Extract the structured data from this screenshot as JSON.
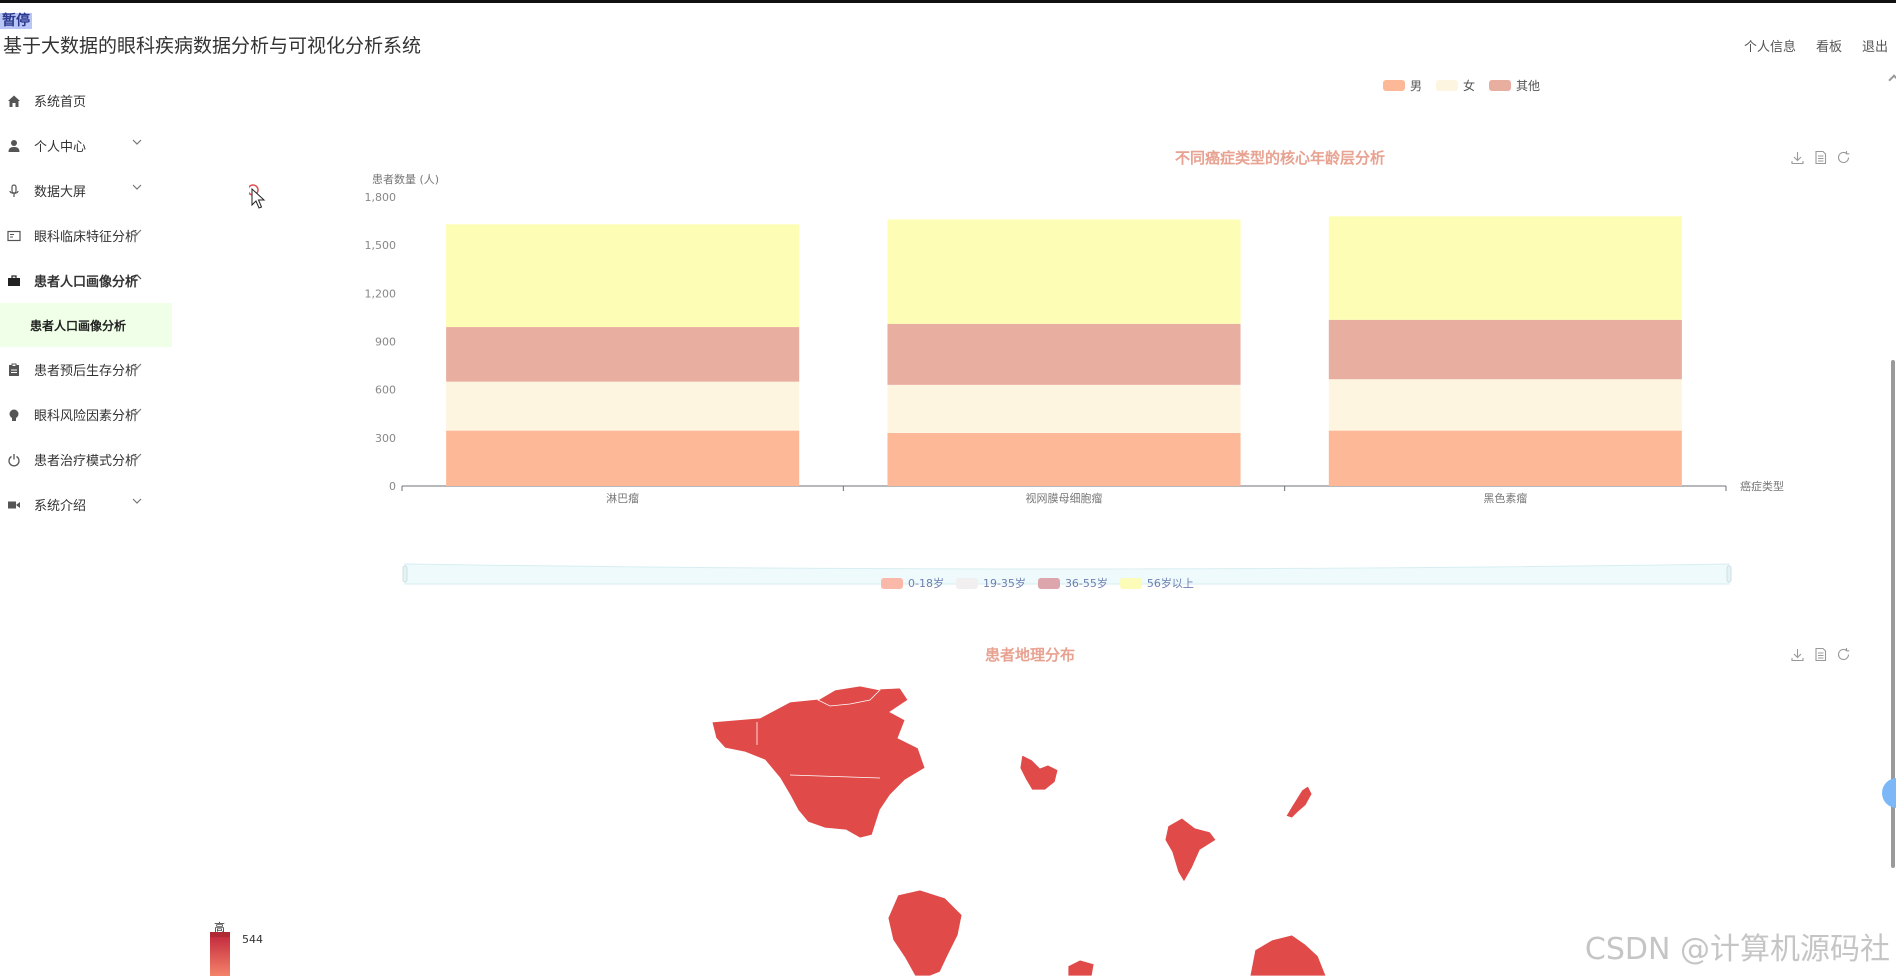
{
  "header": {
    "pause_tag": "暂停",
    "app_title": "基于大数据的眼科疾病数据分析与可视化分析系统",
    "links": [
      "个人信息",
      "看板",
      "退出"
    ]
  },
  "sidebar": {
    "items": [
      {
        "label": "系统首页",
        "icon": "home-icon",
        "has_chevron": false
      },
      {
        "label": "个人中心",
        "icon": "user-icon",
        "has_chevron": true
      },
      {
        "label": "数据大屏",
        "icon": "microphone-icon",
        "has_chevron": true
      },
      {
        "label": "眼科临床特征分析",
        "icon": "id-card-icon",
        "has_chevron": true
      },
      {
        "label": "患者人口画像分析",
        "icon": "briefcase-icon",
        "has_chevron": true,
        "expanded": true
      },
      {
        "label": "患者预后生存分析",
        "icon": "clipboard-icon",
        "has_chevron": true
      },
      {
        "label": "眼科风险因素分析",
        "icon": "bulb-icon",
        "has_chevron": true
      },
      {
        "label": "患者治疗模式分析",
        "icon": "power-icon",
        "has_chevron": true
      },
      {
        "label": "系统介绍",
        "icon": "video-icon",
        "has_chevron": true
      }
    ],
    "sub_item": "患者人口画像分析"
  },
  "gender_legend": [
    {
      "name": "男",
      "color": "#fdb897"
    },
    {
      "name": "女",
      "color": "#fdf5e0"
    },
    {
      "name": "其他",
      "color": "#e8aea0"
    }
  ],
  "chart_data": {
    "type": "bar",
    "stacked": true,
    "title": "不同癌症类型的核心年龄层分析",
    "xlabel": "癌症类型",
    "ylabel": "患者数量 (人)",
    "ylim": [
      0,
      1800
    ],
    "yticks": [
      "0",
      "300",
      "600",
      "900",
      "1,200",
      "1,500",
      "1,800"
    ],
    "categories": [
      "淋巴瘤",
      "视网膜母细胞瘤",
      "黑色素瘤"
    ],
    "series": [
      {
        "name": "0-18岁",
        "color": "#fdb897",
        "values": [
          345,
          330,
          345
        ]
      },
      {
        "name": "19-35岁",
        "color": "#fdf5e0",
        "values": [
          305,
          300,
          320
        ]
      },
      {
        "name": "36-55岁",
        "color": "#e8aea0",
        "values": [
          340,
          380,
          370
        ]
      },
      {
        "name": "56岁以上",
        "color": "#fefdb5",
        "values": [
          640,
          650,
          645
        ]
      }
    ],
    "legend_position": "bottom",
    "grid": false
  },
  "map_chart": {
    "title": "患者地理分布",
    "visual_map": {
      "label": "高",
      "value": "544"
    }
  },
  "watermark": "CSDN @计算机源码社"
}
